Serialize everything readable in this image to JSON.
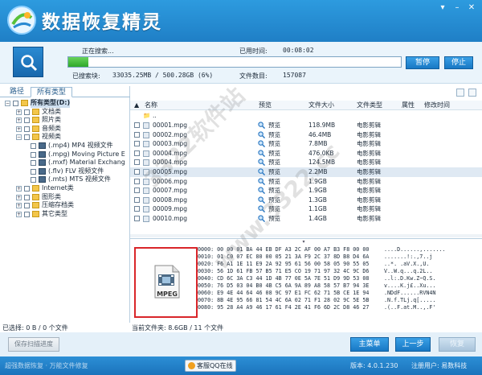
{
  "app": {
    "title": "数据恢复精灵",
    "window_controls": [
      "settings",
      "minimize",
      "close"
    ]
  },
  "search": {
    "status_label": "正在搜索...",
    "status_value": "",
    "elapsed_label": "已用时间:",
    "elapsed_value": "00:08:02",
    "searched_label": "已搜索块:",
    "searched_value": "33035.25MB / 500.28GB (6%)",
    "files_label": "文件数目:",
    "files_value": "157087",
    "progress_fraction": 0.06,
    "pause_label": "暂停",
    "stop_label": "停止"
  },
  "left_tabs": [
    {
      "label": "路径",
      "active": false
    },
    {
      "label": "所有类型",
      "active": true
    }
  ],
  "tree": [
    {
      "label": "所有类型(D:)",
      "bold": true
    },
    {
      "label": "文档类"
    },
    {
      "label": "照片类"
    },
    {
      "label": "音频类"
    },
    {
      "label": "视频类"
    },
    {
      "label": "(.mp4) MP4 视频文件"
    },
    {
      "label": "(.mpg) Moving Picture E"
    },
    {
      "label": "(.mxf) Material Exchang"
    },
    {
      "label": "(.flv) FLV 视频文件"
    },
    {
      "label": "(.mts) MTS 视频文件"
    },
    {
      "label": "Internet类"
    },
    {
      "label": "图形类"
    },
    {
      "label": "压缩存档类"
    },
    {
      "label": "其它类型"
    }
  ],
  "list": {
    "headers": {
      "name": "名称",
      "preview": "预览",
      "size": "文件大小",
      "type": "文件类型",
      "attr": "属性",
      "modified": "修改时间"
    },
    "parent": "..",
    "rows": [
      {
        "name": "00001.mpg",
        "preview": "预览",
        "size": "118.9MB",
        "type": "电影剪辑",
        "selected": false
      },
      {
        "name": "00002.mpg",
        "preview": "预览",
        "size": "46.4MB",
        "type": "电影剪辑",
        "selected": false
      },
      {
        "name": "00003.mpg",
        "preview": "预览",
        "size": "7.8MB",
        "type": "电影剪辑",
        "selected": false
      },
      {
        "name": "00004.mpg",
        "preview": "预览",
        "size": "476.0KB",
        "type": "电影剪辑",
        "selected": false
      },
      {
        "name": "00004.mpg",
        "preview": "预览",
        "size": "124.5MB",
        "type": "电影剪辑",
        "selected": false
      },
      {
        "name": "00005.mpg",
        "preview": "预览",
        "size": "2.2MB",
        "type": "电影剪辑",
        "selected": true
      },
      {
        "name": "00006.mpg",
        "preview": "预览",
        "size": "1.9GB",
        "type": "电影剪辑",
        "selected": false
      },
      {
        "name": "00007.mpg",
        "preview": "预览",
        "size": "1.9GB",
        "type": "电影剪辑",
        "selected": false
      },
      {
        "name": "00008.mpg",
        "preview": "预览",
        "size": "1.3GB",
        "type": "电影剪辑",
        "selected": false
      },
      {
        "name": "00009.mpg",
        "preview": "预览",
        "size": "1.1GB",
        "type": "电影剪辑",
        "selected": false
      },
      {
        "name": "00010.mpg",
        "preview": "预览",
        "size": "1.4GB",
        "type": "电影剪辑",
        "selected": false
      }
    ]
  },
  "preview": {
    "thumb_label": "MPEG",
    "hex_lines": [
      "0000: 00 00 01 BA 44 EB DF A3 2C AF 00 A7 B3 F8 00 00",
      "0010: 01 C0 07 EC 80 00 05 21 3A F9 2C 37 8D B8 D4 6A",
      "0020: F6 A1 1E 11 E9 2A 92 95 61 56 00 58 05 90 55 05",
      "0030: 56 1D 61 FB 57 B5 71 E5 CO 19 71 97 32 4C 9C D6",
      "0040: CD 6C 3A C3 44 1D 4B 77 0E 5A 7E 51 D9 9D 53 08",
      "0050: 76 D5 03 04 B0 4B C5 6A 9A 89 A8 58 57 B7 94 3E",
      "0060: E9 4E 44 64 46 08 9C 97 E1 FC 62 71 5B CE 1E 94",
      "0070: 8B 4E 95 66 81 54 4C 6A 02 71 F1 28 02 9C 5E 5B",
      "0080: 95 28 A4 A9 46 17 61 F4 2E 41 F6 6D 2C D8 46 27"
    ],
    "ascii_lines": [
      "....D......,.......",
      ".......!:.,7..j",
      "..*. .aV.X.,U.",
      "V..W.q...q.2L..",
      "..l:.D.Kw.Z~Q.S.",
      "v....K.j£..Xu...",
      ".NDdF......RVN4N",
      ".N.f.TLj.q[.....",
      ".(..F.at.M..,.F'"
    ]
  },
  "status": {
    "selected": "已选择: 0 B / 0 个文件",
    "current_folder": "当前文件夹: 8.6GB / 11 个文件"
  },
  "actions": {
    "save_scan": "保存扫描进度",
    "main_menu": "主菜单",
    "prev_step": "上一步",
    "recover": "恢复"
  },
  "footer": {
    "left_text": "超强数据恢复 · 万能文件修复",
    "qq_button": "客服QQ在线",
    "version": "版本: 4.0.1.230",
    "register": "注册用户: 易数科技"
  },
  "watermarks": [
    "3322软件站",
    "www.3322.cc"
  ]
}
